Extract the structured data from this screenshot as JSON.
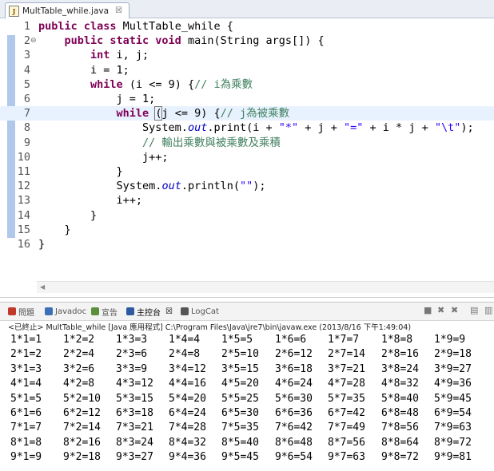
{
  "editor": {
    "tab_label": "MultTable_while.java",
    "tab_close": "☒",
    "fold_marker": "⊖",
    "lines": [
      {
        "num": "1",
        "tokens": [
          {
            "t": "public class ",
            "c": "kw"
          },
          {
            "t": "MultTable_while {"
          }
        ]
      },
      {
        "num": "2",
        "tokens": [
          {
            "t": "    "
          },
          {
            "t": "public static void ",
            "c": "kw"
          },
          {
            "t": "main(String args[]) {"
          }
        ]
      },
      {
        "num": "3",
        "tokens": [
          {
            "t": "        "
          },
          {
            "t": "int ",
            "c": "kw"
          },
          {
            "t": "i, j;"
          }
        ]
      },
      {
        "num": "4",
        "tokens": [
          {
            "t": "        i = 1;"
          }
        ]
      },
      {
        "num": "5",
        "tokens": [
          {
            "t": "        "
          },
          {
            "t": "while ",
            "c": "kw"
          },
          {
            "t": "(i <= 9) {"
          },
          {
            "t": "// i為乘數",
            "c": "cmt"
          }
        ]
      },
      {
        "num": "6",
        "tokens": [
          {
            "t": "            j = 1;"
          }
        ]
      },
      {
        "num": "7",
        "tokens": [
          {
            "t": "            "
          },
          {
            "t": "while ",
            "c": "kw"
          },
          {
            "t": "(",
            "c": "bm"
          },
          {
            "t": "j <= 9) {"
          },
          {
            "t": "// j為被乘數",
            "c": "cmt"
          }
        ]
      },
      {
        "num": "8",
        "tokens": [
          {
            "t": "                System."
          },
          {
            "t": "out",
            "c": "fld"
          },
          {
            "t": ".print(i + "
          },
          {
            "t": "\"*\"",
            "c": "str"
          },
          {
            "t": " + j + "
          },
          {
            "t": "\"=\"",
            "c": "str"
          },
          {
            "t": " + i * j + "
          },
          {
            "t": "\"\\t\"",
            "c": "str"
          },
          {
            "t": ");"
          }
        ]
      },
      {
        "num": "9",
        "tokens": [
          {
            "t": "                "
          },
          {
            "t": "// 輸出乘數與被乘數及乘積",
            "c": "cmt"
          }
        ]
      },
      {
        "num": "10",
        "tokens": [
          {
            "t": "                j++;"
          }
        ]
      },
      {
        "num": "11",
        "tokens": [
          {
            "t": "            }"
          }
        ]
      },
      {
        "num": "12",
        "tokens": [
          {
            "t": "            System."
          },
          {
            "t": "out",
            "c": "fld"
          },
          {
            "t": ".println("
          },
          {
            "t": "\"\"",
            "c": "str"
          },
          {
            "t": ");"
          }
        ]
      },
      {
        "num": "13",
        "tokens": [
          {
            "t": "            i++;"
          }
        ]
      },
      {
        "num": "14",
        "tokens": [
          {
            "t": "        }"
          }
        ]
      },
      {
        "num": "15",
        "tokens": [
          {
            "t": "    }"
          }
        ]
      },
      {
        "num": "16",
        "tokens": [
          {
            "t": "}"
          }
        ]
      }
    ]
  },
  "console": {
    "tabs": [
      {
        "label": "問題",
        "icon": "problems-icon",
        "color": "#c0392b"
      },
      {
        "label": "Javadoc",
        "icon": "javadoc-icon",
        "color": "#3b6fb6"
      },
      {
        "label": "宣告",
        "icon": "declaration-icon",
        "color": "#5b8f3a"
      },
      {
        "label": "主控台",
        "icon": "console-icon",
        "color": "#2d5aa0",
        "active": true,
        "close": "☒"
      },
      {
        "label": "LogCat",
        "icon": "logcat-icon",
        "color": "#555555"
      }
    ],
    "status": "<已終止> MultTable_while [Java 應用程式] C:\\Program Files\\Java\\jre7\\bin\\javaw.exe (2013/8/16 下午1:49:04)",
    "output_rows": [
      [
        "1*1=1",
        "1*2=2",
        "1*3=3",
        "1*4=4",
        "1*5=5",
        "1*6=6",
        "1*7=7",
        "1*8=8",
        "1*9=9"
      ],
      [
        "2*1=2",
        "2*2=4",
        "2*3=6",
        "2*4=8",
        "2*5=10",
        "2*6=12",
        "2*7=14",
        "2*8=16",
        "2*9=18"
      ],
      [
        "3*1=3",
        "3*2=6",
        "3*3=9",
        "3*4=12",
        "3*5=15",
        "3*6=18",
        "3*7=21",
        "3*8=24",
        "3*9=27"
      ],
      [
        "4*1=4",
        "4*2=8",
        "4*3=12",
        "4*4=16",
        "4*5=20",
        "4*6=24",
        "4*7=28",
        "4*8=32",
        "4*9=36"
      ],
      [
        "5*1=5",
        "5*2=10",
        "5*3=15",
        "5*4=20",
        "5*5=25",
        "5*6=30",
        "5*7=35",
        "5*8=40",
        "5*9=45"
      ],
      [
        "6*1=6",
        "6*2=12",
        "6*3=18",
        "6*4=24",
        "6*5=30",
        "6*6=36",
        "6*7=42",
        "6*8=48",
        "6*9=54"
      ],
      [
        "7*1=7",
        "7*2=14",
        "7*3=21",
        "7*4=28",
        "7*5=35",
        "7*6=42",
        "7*7=49",
        "7*8=56",
        "7*9=63"
      ],
      [
        "8*1=8",
        "8*2=16",
        "8*3=24",
        "8*4=32",
        "8*5=40",
        "8*6=48",
        "8*7=56",
        "8*8=64",
        "8*9=72"
      ],
      [
        "9*1=9",
        "9*2=18",
        "9*3=27",
        "9*4=36",
        "9*5=45",
        "9*6=54",
        "9*7=63",
        "9*8=72",
        "9*9=81"
      ]
    ]
  }
}
